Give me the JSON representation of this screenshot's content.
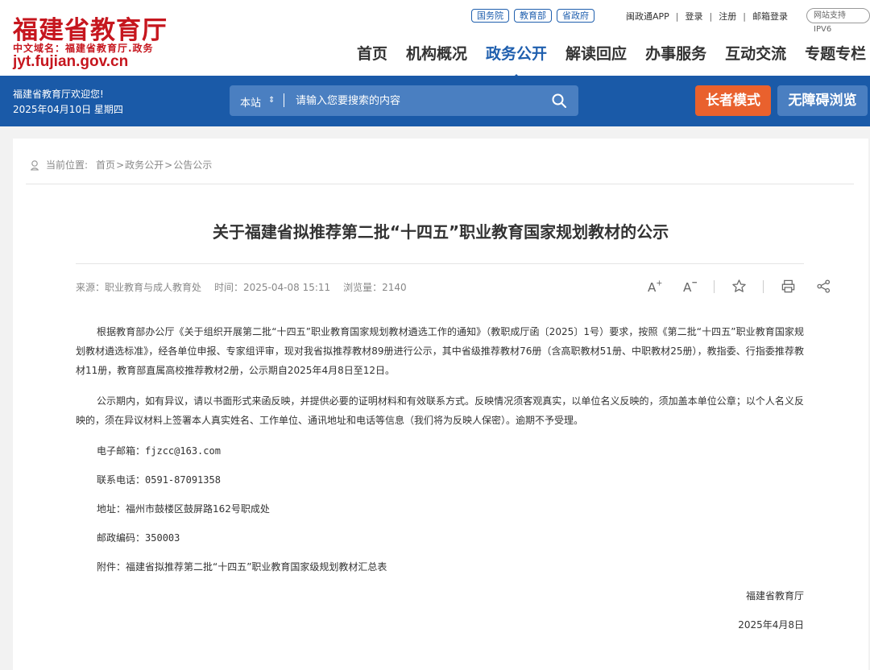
{
  "header": {
    "site_name": "福建省教育厅",
    "site_subtitle": "中文域名：福建省教育厅.政务",
    "domain": "jyt.fujian.gov.cn",
    "gov_links": [
      "国务院",
      "教育部",
      "省政府"
    ],
    "util_links": [
      "闽政通APP",
      "登录",
      "注册",
      "邮箱登录"
    ],
    "ipv6_badge": "网站支持IPV6",
    "nav": [
      "首页",
      "机构概况",
      "政务公开",
      "解读回应",
      "办事服务",
      "互动交流",
      "专题专栏"
    ],
    "active_nav": "政务公开"
  },
  "band": {
    "welcome": "福建省教育厅欢迎您!",
    "date": "2025年04月10日 星期四",
    "search_scope": "本站",
    "search_placeholder": "请输入您要搜索的内容",
    "elder_mode": "长者模式",
    "accessible": "无障碍浏览",
    "colors": {
      "band": "#1a5aa8",
      "elder": "#e9612d",
      "accent_red": "#c6161e"
    }
  },
  "breadcrumb": {
    "label": "当前位置:",
    "items": [
      "首页",
      "政务公开",
      "公告公示"
    ]
  },
  "article": {
    "title": "关于福建省拟推荐第二批“十四五”职业教育国家规划教材的公示",
    "source": "来源：职业教育与成人教育处",
    "time": "时间：2025-04-08 15:11",
    "views": "浏览量：2140",
    "paragraphs": [
      "根据教育部办公厅《关于组织开展第二批“十四五”职业教育国家规划教材遴选工作的通知》（教职成厅函〔2025〕1号）要求，按照《第二批“十四五”职业教育国家规划教材遴选标准》，经各单位申报、专家组评审，现对我省拟推荐教材89册进行公示，其中省级推荐教材76册（含高职教材51册、中职教材25册），教指委、行指委推荐教材11册，教育部直属高校推荐教材2册，公示期自2025年4月8日至12日。",
      "公示期内，如有异议，请以书面形式来函反映，并提供必要的证明材料和有效联系方式。反映情况须客观真实，以单位名义反映的，须加盖本单位公章；以个人名义反映的，须在异议材料上签署本人真实姓名、工作单位、通讯地址和电话等信息（我们将为反映人保密）。逾期不予受理。"
    ],
    "email_label": "电子邮箱：",
    "email": "fjzcc@163.com",
    "phone_label": "联系电话：",
    "phone": "0591-87091358",
    "address": "地址：福州市鼓楼区鼓屏路162号职成处",
    "postcode_label": "邮政编码：",
    "postcode": "350003",
    "attachment": "附件：福建省拟推荐第二批“十四五”职业教育国家级规划教材汇总表",
    "signature": "福建省教育厅",
    "sign_date": "2025年4月8日"
  }
}
